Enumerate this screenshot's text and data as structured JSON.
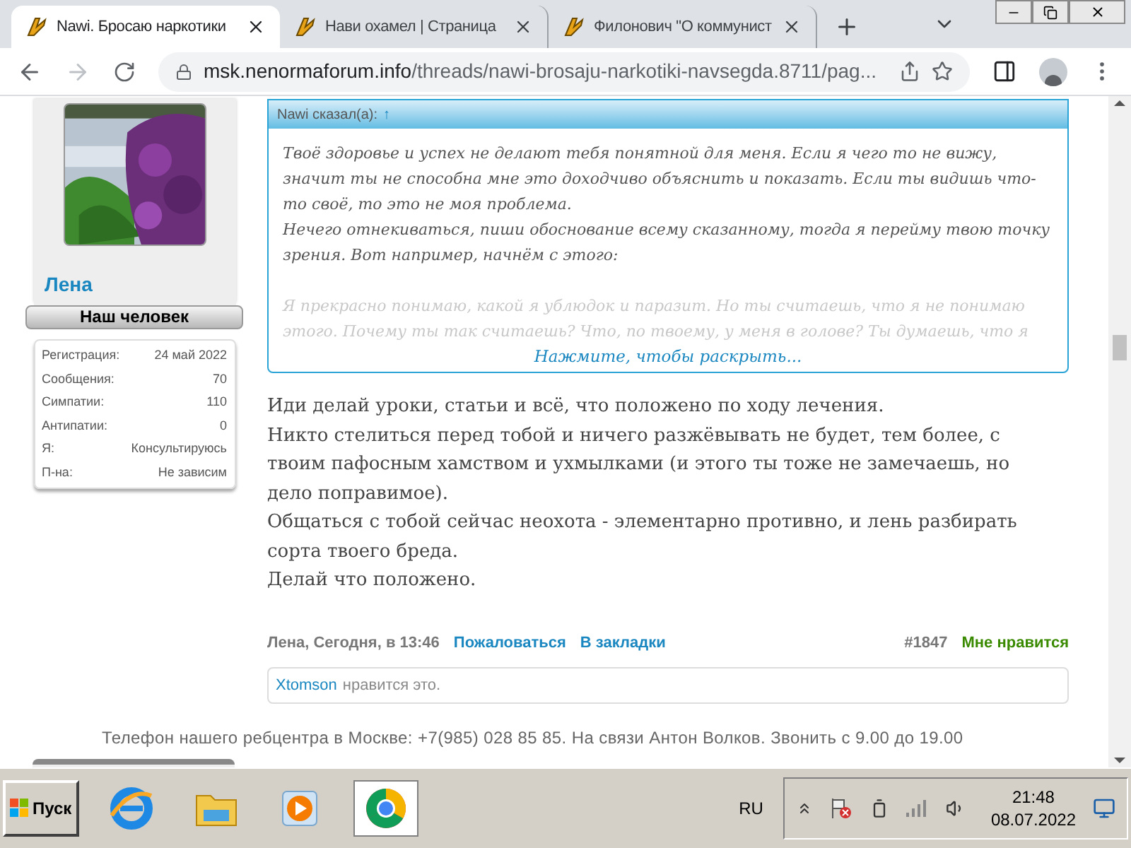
{
  "browser": {
    "tabs": [
      {
        "title": "Nawi. Бросаю наркотики",
        "selected": true
      },
      {
        "title": "Нави охамел | Страница",
        "selected": false
      },
      {
        "title": "Филонович \"О коммунист",
        "selected": false
      }
    ],
    "url_host": "msk.nenormaforum.info",
    "url_path": "/threads/nawi-brosaju-narkotiki-navsegda.8711/pag..."
  },
  "user": {
    "name": "Лена",
    "title": "Наш человек",
    "stats": [
      {
        "label": "Регистрация:",
        "value": "24 май 2022"
      },
      {
        "label": "Сообщения:",
        "value": "70"
      },
      {
        "label": "Симпатии:",
        "value": "110"
      },
      {
        "label": "Антипатии:",
        "value": "0"
      },
      {
        "label": "Я:",
        "value": "Консультируюсь"
      },
      {
        "label": "П-на:",
        "value": "Не зависим"
      }
    ]
  },
  "quote": {
    "header": "Nawi сказал(а):",
    "arrow": "↑",
    "lines": [
      "Твоё здоровье и успех не делают тебя понятной для меня. Если я чего то не вижу, значит ты не способна мне это доходчиво объяснить и показать. Если ты видишь что-то своё, то это не моя проблема.",
      "Нечего отнекиваться, пиши обоснование всему сказанному, тогда я перейму твою точку зрения. Вот например, начнём с этого:"
    ],
    "faded": "Я прекрасно понимаю, какой я ублюдок и паразит. Но ты считаешь, что я не понимаю этого. Почему ты так считаешь? Что, по твоему, у меня в голове? Ты думаешь, что я",
    "expand": "Нажмите, чтобы раскрыть..."
  },
  "post": [
    "Иди делай уроки, статьи и всё, что положено по ходу лечения.",
    "Никто стелиться перед тобой и ничего разжёвывать не будет, тем более, с твоим пафосным хамством и ухмылками (и этого ты тоже не замечаешь, но дело поправимое).",
    "Общаться с тобой сейчас неохота - элементарно противно, и лень разбирать сорта твоего бреда.",
    "Делай что положено."
  ],
  "meta": {
    "author_date": "Лена, Сегодня, в 13:46",
    "links": [
      "Пожаловаться",
      "В закладки"
    ],
    "number": "#1847",
    "like": "Мне нравится"
  },
  "likes": {
    "user": "Xtomson",
    "text": "нравится это."
  },
  "footer_text": "Телефон нашего ребцентра в Москве: +7(985) 028 85 85. На связи Антон Волков. Звонить с 9.00 до 19.00",
  "taskbar": {
    "start": "Пуск",
    "apps": [
      {
        "kind": "ie",
        "selected": false
      },
      {
        "kind": "folder",
        "selected": false
      },
      {
        "kind": "media",
        "selected": false
      },
      {
        "kind": "chrome",
        "selected": true
      }
    ],
    "lang": "RU",
    "time": "21:48",
    "date": "08.07.2022"
  }
}
